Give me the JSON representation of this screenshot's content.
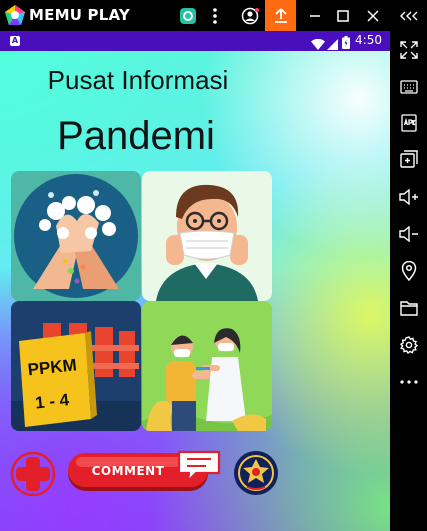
{
  "window": {
    "brand_name": "MEMU PLAY",
    "icons": [
      "memu-logo-icon",
      "app-store-icon",
      "more-vert-icon",
      "account-icon",
      "upload-icon",
      "minimize-icon",
      "maximize-icon",
      "close-icon",
      "collapse-sidebar-icon"
    ]
  },
  "sidebar": {
    "items": [
      "fullscreen-icon",
      "keyboard-mapping-icon",
      "apk-install-icon",
      "add-window-icon",
      "volume-up-icon",
      "volume-down-icon",
      "location-icon",
      "folder-icon",
      "settings-icon",
      "more-icon"
    ]
  },
  "statusbar": {
    "app_badge": "A",
    "time": "4:50"
  },
  "app": {
    "subtitle": "Pusat Informasi",
    "title": "Pandemi",
    "tiles": [
      {
        "name": "tile-hand-washing",
        "image": "hand-washing-illustration"
      },
      {
        "name": "tile-mask",
        "image": "masked-person-illustration"
      },
      {
        "name": "tile-ppkm",
        "image": "ppkm-sign-illustration",
        "sign_line1": "PPKM",
        "sign_line2": "1 - 4"
      },
      {
        "name": "tile-vaccination",
        "image": "vaccination-illustration"
      }
    ],
    "comment_button": "COMMENT",
    "colors": {
      "comment_red": "#e3202a",
      "plus_red": "#e3202a",
      "status_bar": "#4a0fbd",
      "upload_orange": "#ff6a13"
    }
  }
}
